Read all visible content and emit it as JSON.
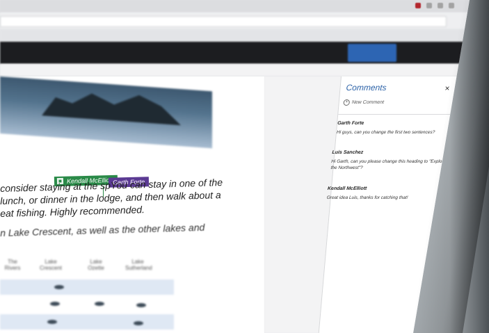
{
  "browser": {
    "url_text": "",
    "tab_title": "",
    "doc_title": "",
    "share_label": "",
    "nav_item_1": "",
    "nav_item_2": ""
  },
  "document": {
    "paragraph_lines": [
      "consider staying at the spYou can stay in one of the",
      "lunch, or dinner in the lodge, and then walk about a",
      "eat fishing. Highly recommended."
    ],
    "paragraph2": "n Lake Crescent, as well as the other lakes and",
    "presence_tags": {
      "kendall": "Kendall McElliott",
      "garth": "Garth Forte"
    },
    "table": {
      "headers": [
        "The Rivers",
        "Lake Crescent",
        "Lake Ozette",
        "Lake Sutherland"
      ]
    }
  },
  "comments_panel": {
    "title": "Comments",
    "close_label": "×",
    "new_comment_label": "New Comment",
    "comments": [
      {
        "author": "Garth Forte",
        "body": "Hi guys, can you change the first two sentences?"
      },
      {
        "author": "Luis Sanchez",
        "body": "Hi Garth, can you please change this heading to \"Explore the Northwest\"?"
      },
      {
        "author": "Kendall McElliott",
        "body": "Great idea Luis, thanks for catching that!"
      }
    ]
  },
  "colors": {
    "accent_blue": "#2d63a8",
    "kendall_tag": "#2a8a48",
    "garth_tag": "#5b3a93",
    "app_bar": "#1c1d20"
  }
}
